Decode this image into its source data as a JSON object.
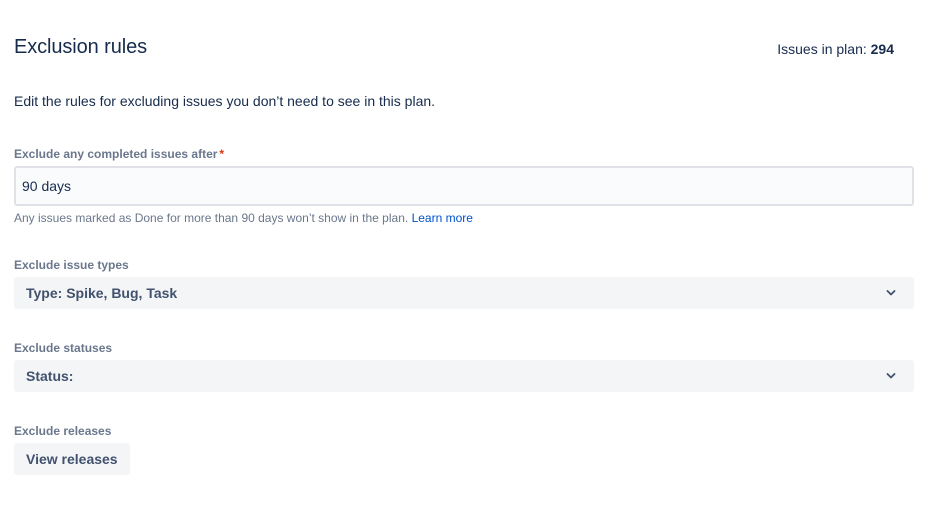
{
  "header": {
    "title": "Exclusion rules",
    "issues_label": "Issues in plan:",
    "issues_count": "294"
  },
  "description": "Edit the rules for excluding issues you don’t need to see in this plan.",
  "completed": {
    "label": "Exclude any completed issues after",
    "required_mark": "*",
    "value": "90 days",
    "helper": "Any issues marked as Done for more than 90 days won’t show in the plan.",
    "learn_more": "Learn more"
  },
  "issue_types": {
    "label": "Exclude issue types",
    "value": "Type: Spike, Bug, Task"
  },
  "statuses": {
    "label": "Exclude statuses",
    "value": "Status:"
  },
  "releases": {
    "label": "Exclude releases",
    "button": "View releases"
  },
  "colors": {
    "text": "#172b4d",
    "subtle": "#6b778c",
    "link": "#0052cc",
    "required": "#de350b",
    "field_bg": "#f4f5f7"
  },
  "icons": {
    "dropdown": "chevron-down-icon"
  }
}
